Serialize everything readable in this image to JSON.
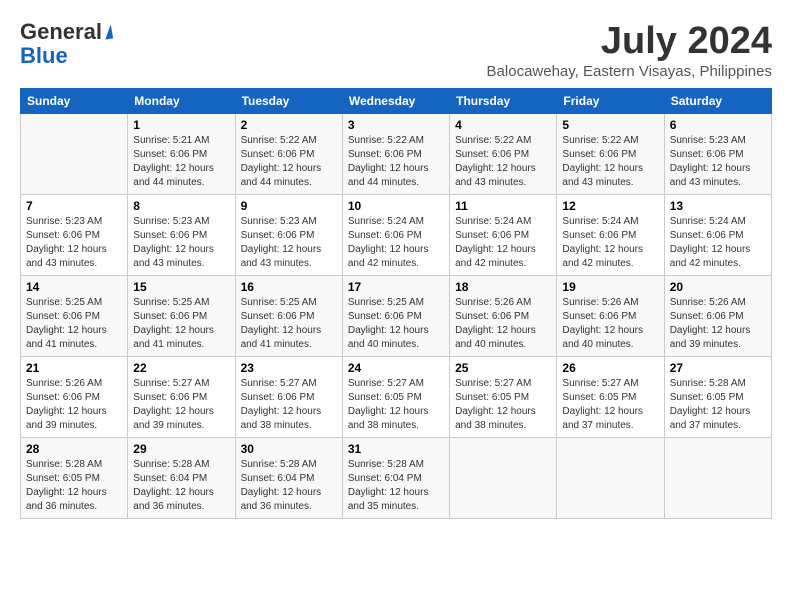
{
  "header": {
    "logo_general": "General",
    "logo_blue": "Blue",
    "month_title": "July 2024",
    "location": "Balocawehay, Eastern Visayas, Philippines"
  },
  "days_of_week": [
    "Sunday",
    "Monday",
    "Tuesday",
    "Wednesday",
    "Thursday",
    "Friday",
    "Saturday"
  ],
  "weeks": [
    [
      {
        "day": "",
        "info": ""
      },
      {
        "day": "1",
        "info": "Sunrise: 5:21 AM\nSunset: 6:06 PM\nDaylight: 12 hours\nand 44 minutes."
      },
      {
        "day": "2",
        "info": "Sunrise: 5:22 AM\nSunset: 6:06 PM\nDaylight: 12 hours\nand 44 minutes."
      },
      {
        "day": "3",
        "info": "Sunrise: 5:22 AM\nSunset: 6:06 PM\nDaylight: 12 hours\nand 44 minutes."
      },
      {
        "day": "4",
        "info": "Sunrise: 5:22 AM\nSunset: 6:06 PM\nDaylight: 12 hours\nand 43 minutes."
      },
      {
        "day": "5",
        "info": "Sunrise: 5:22 AM\nSunset: 6:06 PM\nDaylight: 12 hours\nand 43 minutes."
      },
      {
        "day": "6",
        "info": "Sunrise: 5:23 AM\nSunset: 6:06 PM\nDaylight: 12 hours\nand 43 minutes."
      }
    ],
    [
      {
        "day": "7",
        "info": "Sunrise: 5:23 AM\nSunset: 6:06 PM\nDaylight: 12 hours\nand 43 minutes."
      },
      {
        "day": "8",
        "info": "Sunrise: 5:23 AM\nSunset: 6:06 PM\nDaylight: 12 hours\nand 43 minutes."
      },
      {
        "day": "9",
        "info": "Sunrise: 5:23 AM\nSunset: 6:06 PM\nDaylight: 12 hours\nand 43 minutes."
      },
      {
        "day": "10",
        "info": "Sunrise: 5:24 AM\nSunset: 6:06 PM\nDaylight: 12 hours\nand 42 minutes."
      },
      {
        "day": "11",
        "info": "Sunrise: 5:24 AM\nSunset: 6:06 PM\nDaylight: 12 hours\nand 42 minutes."
      },
      {
        "day": "12",
        "info": "Sunrise: 5:24 AM\nSunset: 6:06 PM\nDaylight: 12 hours\nand 42 minutes."
      },
      {
        "day": "13",
        "info": "Sunrise: 5:24 AM\nSunset: 6:06 PM\nDaylight: 12 hours\nand 42 minutes."
      }
    ],
    [
      {
        "day": "14",
        "info": "Sunrise: 5:25 AM\nSunset: 6:06 PM\nDaylight: 12 hours\nand 41 minutes."
      },
      {
        "day": "15",
        "info": "Sunrise: 5:25 AM\nSunset: 6:06 PM\nDaylight: 12 hours\nand 41 minutes."
      },
      {
        "day": "16",
        "info": "Sunrise: 5:25 AM\nSunset: 6:06 PM\nDaylight: 12 hours\nand 41 minutes."
      },
      {
        "day": "17",
        "info": "Sunrise: 5:25 AM\nSunset: 6:06 PM\nDaylight: 12 hours\nand 40 minutes."
      },
      {
        "day": "18",
        "info": "Sunrise: 5:26 AM\nSunset: 6:06 PM\nDaylight: 12 hours\nand 40 minutes."
      },
      {
        "day": "19",
        "info": "Sunrise: 5:26 AM\nSunset: 6:06 PM\nDaylight: 12 hours\nand 40 minutes."
      },
      {
        "day": "20",
        "info": "Sunrise: 5:26 AM\nSunset: 6:06 PM\nDaylight: 12 hours\nand 39 minutes."
      }
    ],
    [
      {
        "day": "21",
        "info": "Sunrise: 5:26 AM\nSunset: 6:06 PM\nDaylight: 12 hours\nand 39 minutes."
      },
      {
        "day": "22",
        "info": "Sunrise: 5:27 AM\nSunset: 6:06 PM\nDaylight: 12 hours\nand 39 minutes."
      },
      {
        "day": "23",
        "info": "Sunrise: 5:27 AM\nSunset: 6:06 PM\nDaylight: 12 hours\nand 38 minutes."
      },
      {
        "day": "24",
        "info": "Sunrise: 5:27 AM\nSunset: 6:05 PM\nDaylight: 12 hours\nand 38 minutes."
      },
      {
        "day": "25",
        "info": "Sunrise: 5:27 AM\nSunset: 6:05 PM\nDaylight: 12 hours\nand 38 minutes."
      },
      {
        "day": "26",
        "info": "Sunrise: 5:27 AM\nSunset: 6:05 PM\nDaylight: 12 hours\nand 37 minutes."
      },
      {
        "day": "27",
        "info": "Sunrise: 5:28 AM\nSunset: 6:05 PM\nDaylight: 12 hours\nand 37 minutes."
      }
    ],
    [
      {
        "day": "28",
        "info": "Sunrise: 5:28 AM\nSunset: 6:05 PM\nDaylight: 12 hours\nand 36 minutes."
      },
      {
        "day": "29",
        "info": "Sunrise: 5:28 AM\nSunset: 6:04 PM\nDaylight: 12 hours\nand 36 minutes."
      },
      {
        "day": "30",
        "info": "Sunrise: 5:28 AM\nSunset: 6:04 PM\nDaylight: 12 hours\nand 36 minutes."
      },
      {
        "day": "31",
        "info": "Sunrise: 5:28 AM\nSunset: 6:04 PM\nDaylight: 12 hours\nand 35 minutes."
      },
      {
        "day": "",
        "info": ""
      },
      {
        "day": "",
        "info": ""
      },
      {
        "day": "",
        "info": ""
      }
    ]
  ]
}
